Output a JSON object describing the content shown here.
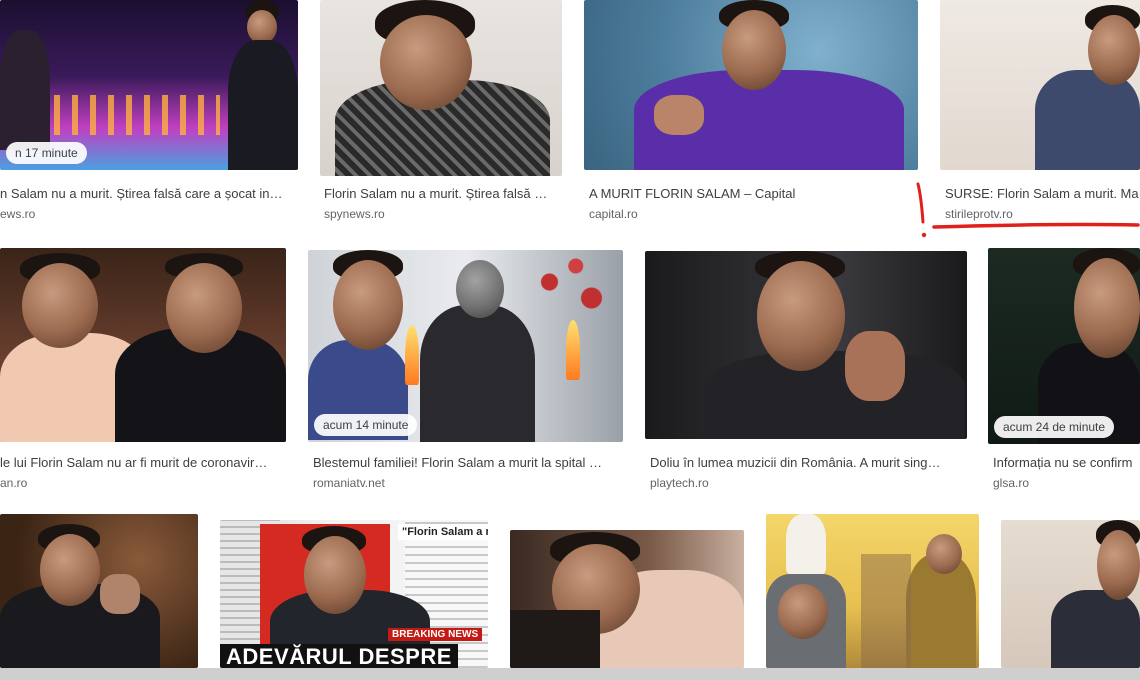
{
  "results": [
    {
      "title": "n Salam nu a murit. Știrea falsă care a șocat in…",
      "source": "ews.ro",
      "badge": "n 17 minute"
    },
    {
      "title": "Florin Salam nu a murit. Știrea falsă …",
      "source": "spynews.ro",
      "badge": ""
    },
    {
      "title": "A MURIT FLORIN SALAM – Capital",
      "source": "capital.ro",
      "badge": ""
    },
    {
      "title": "SURSE: Florin Salam a murit. Ma",
      "source": "stirileprotv.ro",
      "badge": ""
    },
    {
      "title": "le lui Florin Salam nu ar fi murit de coronavir…",
      "source": "an.ro",
      "badge": ""
    },
    {
      "title": "Blestemul familiei! Florin Salam a murit la spital …",
      "source": "romaniatv.net",
      "badge": "acum 14 minute"
    },
    {
      "title": "Doliu în lumea muzicii din România. A murit sing…",
      "source": "playtech.ro",
      "badge": ""
    },
    {
      "title": "Informația nu se confirm",
      "source": "glsa.ro",
      "badge": "acum 24 de minute"
    },
    {
      "title": "",
      "source": "",
      "badge": ""
    },
    {
      "title": "",
      "source": "",
      "badge": "",
      "overlay_quote": "\"Florin Salam a m",
      "overlay_breaking": "BREAKING NEWS",
      "overlay_headline": "ADEVĂRUL DESPRE"
    },
    {
      "title": "",
      "source": "",
      "badge": ""
    },
    {
      "title": "",
      "source": "",
      "badge": ""
    },
    {
      "title": "",
      "source": "",
      "badge": ""
    }
  ],
  "annotation": {
    "mark": "!",
    "color": "#e0201a"
  },
  "colors": {
    "title_text": "#3c4043",
    "source_text": "#5f6368",
    "badge_bg": "#ffffff"
  }
}
